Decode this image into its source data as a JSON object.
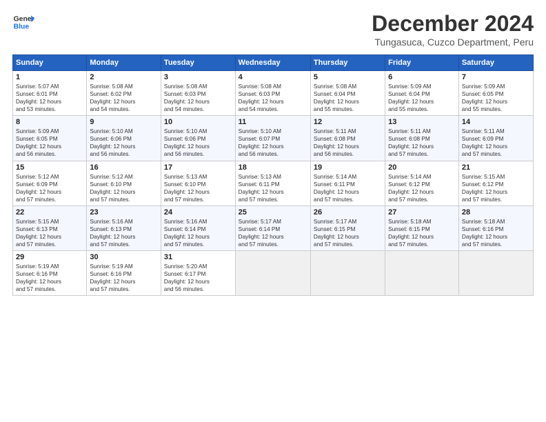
{
  "header": {
    "logo_line1": "General",
    "logo_line2": "Blue",
    "main_title": "December 2024",
    "subtitle": "Tungasuca, Cuzco Department, Peru"
  },
  "calendar": {
    "days_of_week": [
      "Sunday",
      "Monday",
      "Tuesday",
      "Wednesday",
      "Thursday",
      "Friday",
      "Saturday"
    ],
    "weeks": [
      [
        {
          "day": "",
          "detail": ""
        },
        {
          "day": "2",
          "detail": "Sunrise: 5:08 AM\nSunset: 6:02 PM\nDaylight: 12 hours\nand 54 minutes."
        },
        {
          "day": "3",
          "detail": "Sunrise: 5:08 AM\nSunset: 6:03 PM\nDaylight: 12 hours\nand 54 minutes."
        },
        {
          "day": "4",
          "detail": "Sunrise: 5:08 AM\nSunset: 6:03 PM\nDaylight: 12 hours\nand 54 minutes."
        },
        {
          "day": "5",
          "detail": "Sunrise: 5:08 AM\nSunset: 6:04 PM\nDaylight: 12 hours\nand 55 minutes."
        },
        {
          "day": "6",
          "detail": "Sunrise: 5:09 AM\nSunset: 6:04 PM\nDaylight: 12 hours\nand 55 minutes."
        },
        {
          "day": "7",
          "detail": "Sunrise: 5:09 AM\nSunset: 6:05 PM\nDaylight: 12 hours\nand 55 minutes."
        }
      ],
      [
        {
          "day": "1",
          "detail": "Sunrise: 5:07 AM\nSunset: 6:01 PM\nDaylight: 12 hours\nand 53 minutes.",
          "week_start": true
        },
        {
          "day": "9",
          "detail": "Sunrise: 5:10 AM\nSunset: 6:06 PM\nDaylight: 12 hours\nand 56 minutes."
        },
        {
          "day": "10",
          "detail": "Sunrise: 5:10 AM\nSunset: 6:06 PM\nDaylight: 12 hours\nand 56 minutes."
        },
        {
          "day": "11",
          "detail": "Sunrise: 5:10 AM\nSunset: 6:07 PM\nDaylight: 12 hours\nand 56 minutes."
        },
        {
          "day": "12",
          "detail": "Sunrise: 5:11 AM\nSunset: 6:08 PM\nDaylight: 12 hours\nand 56 minutes."
        },
        {
          "day": "13",
          "detail": "Sunrise: 5:11 AM\nSunset: 6:08 PM\nDaylight: 12 hours\nand 57 minutes."
        },
        {
          "day": "14",
          "detail": "Sunrise: 5:11 AM\nSunset: 6:09 PM\nDaylight: 12 hours\nand 57 minutes."
        }
      ],
      [
        {
          "day": "8",
          "detail": "Sunrise: 5:09 AM\nSunset: 6:05 PM\nDaylight: 12 hours\nand 56 minutes."
        },
        {
          "day": "16",
          "detail": "Sunrise: 5:12 AM\nSunset: 6:10 PM\nDaylight: 12 hours\nand 57 minutes."
        },
        {
          "day": "17",
          "detail": "Sunrise: 5:13 AM\nSunset: 6:10 PM\nDaylight: 12 hours\nand 57 minutes."
        },
        {
          "day": "18",
          "detail": "Sunrise: 5:13 AM\nSunset: 6:11 PM\nDaylight: 12 hours\nand 57 minutes."
        },
        {
          "day": "19",
          "detail": "Sunrise: 5:14 AM\nSunset: 6:11 PM\nDaylight: 12 hours\nand 57 minutes."
        },
        {
          "day": "20",
          "detail": "Sunrise: 5:14 AM\nSunset: 6:12 PM\nDaylight: 12 hours\nand 57 minutes."
        },
        {
          "day": "21",
          "detail": "Sunrise: 5:15 AM\nSunset: 6:12 PM\nDaylight: 12 hours\nand 57 minutes."
        }
      ],
      [
        {
          "day": "15",
          "detail": "Sunrise: 5:12 AM\nSunset: 6:09 PM\nDaylight: 12 hours\nand 57 minutes."
        },
        {
          "day": "23",
          "detail": "Sunrise: 5:16 AM\nSunset: 6:13 PM\nDaylight: 12 hours\nand 57 minutes."
        },
        {
          "day": "24",
          "detail": "Sunrise: 5:16 AM\nSunset: 6:14 PM\nDaylight: 12 hours\nand 57 minutes."
        },
        {
          "day": "25",
          "detail": "Sunrise: 5:17 AM\nSunset: 6:14 PM\nDaylight: 12 hours\nand 57 minutes."
        },
        {
          "day": "26",
          "detail": "Sunrise: 5:17 AM\nSunset: 6:15 PM\nDaylight: 12 hours\nand 57 minutes."
        },
        {
          "day": "27",
          "detail": "Sunrise: 5:18 AM\nSunset: 6:15 PM\nDaylight: 12 hours\nand 57 minutes."
        },
        {
          "day": "28",
          "detail": "Sunrise: 5:18 AM\nSunset: 6:16 PM\nDaylight: 12 hours\nand 57 minutes."
        }
      ],
      [
        {
          "day": "22",
          "detail": "Sunrise: 5:15 AM\nSunset: 6:13 PM\nDaylight: 12 hours\nand 57 minutes."
        },
        {
          "day": "30",
          "detail": "Sunrise: 5:19 AM\nSunset: 6:16 PM\nDaylight: 12 hours\nand 57 minutes."
        },
        {
          "day": "31",
          "detail": "Sunrise: 5:20 AM\nSunset: 6:17 PM\nDaylight: 12 hours\nand 56 minutes."
        },
        {
          "day": "",
          "detail": ""
        },
        {
          "day": "",
          "detail": ""
        },
        {
          "day": "",
          "detail": ""
        },
        {
          "day": "",
          "detail": ""
        }
      ],
      [
        {
          "day": "29",
          "detail": "Sunrise: 5:19 AM\nSunset: 6:16 PM\nDaylight: 12 hours\nand 57 minutes."
        },
        {
          "day": "",
          "detail": ""
        },
        {
          "day": "",
          "detail": ""
        },
        {
          "day": "",
          "detail": ""
        },
        {
          "day": "",
          "detail": ""
        },
        {
          "day": "",
          "detail": ""
        },
        {
          "day": "",
          "detail": ""
        }
      ]
    ]
  }
}
